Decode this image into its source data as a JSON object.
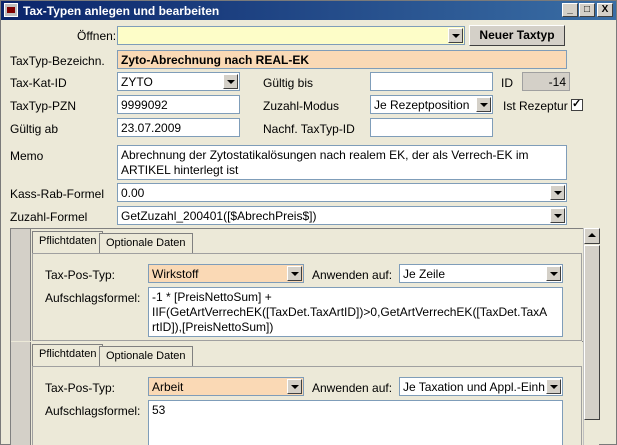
{
  "window": {
    "title": "Tax-Typen anlegen und bearbeiten",
    "min": "_",
    "max": "□",
    "close": "X"
  },
  "header": {
    "open_label": "Öffnen:",
    "open_value": "",
    "new_button": "Neuer Taxtyp"
  },
  "form": {
    "bezeichn_label": "TaxTyp-Bezeichn.",
    "bezeichn_value": "Zyto-Abrechnung nach REAL-EK",
    "katid_label": "Tax-Kat-ID",
    "katid_value": "ZYTO",
    "gueltig_bis_label": "Gültig bis",
    "gueltig_bis_value": "",
    "id_label": "ID",
    "id_value": "-14",
    "pzn_label": "TaxTyp-PZN",
    "pzn_value": "9999092",
    "zuzahl_modus_label": "Zuzahl-Modus",
    "zuzahl_modus_value": "Je Rezeptposition",
    "ist_rezeptur_label": "Ist Rezeptur",
    "gueltig_ab_label": "Gültig ab",
    "gueltig_ab_value": "23.07.2009",
    "nachf_label": "Nachf. TaxTyp-ID",
    "nachf_value": "",
    "memo_label": "Memo",
    "memo_value": "Abrechnung der Zytostatikalösungen nach realem EK, der als Verrech-EK im ARTIKEL hinterlegt ist",
    "kass_label": "Kass-Rab-Formel",
    "kass_value": "0.00",
    "zuzahl_formel_label": "Zuzahl-Formel",
    "zuzahl_formel_value": "GetZuzahl_200401([$AbrechPreis$])"
  },
  "subform": {
    "records": [
      {
        "tabs": [
          "Pflichtdaten",
          "Optionale Daten"
        ],
        "pos_typ_label": "Tax-Pos-Typ:",
        "pos_typ_value": "Wirkstoff",
        "anwenden_label": "Anwenden auf:",
        "anwenden_value": "Je Zeile",
        "aufschlag_label": "Aufschlagsformel:",
        "aufschlag_value": "-1 * [PreisNettoSum] +\nIIF(GetArtVerrechEK([TaxDet.TaxArtID])>0,GetArtVerrechEK([TaxDet.TaxA\nrtID]),[PreisNettoSum])"
      },
      {
        "tabs": [
          "Pflichtdaten",
          "Optionale Daten"
        ],
        "pos_typ_label": "Tax-Pos-Typ:",
        "pos_typ_value": "Arbeit",
        "anwenden_label": "Anwenden auf:",
        "anwenden_value": "Je Taxation und Appl.-Einh",
        "aufschlag_label": "Aufschlagsformel:",
        "aufschlag_value": "53"
      }
    ]
  },
  "colors": {
    "title_start": "#0a246a",
    "title_end": "#3a6ea5",
    "highlight": "#fad9b5",
    "background": "#ece9d8"
  }
}
